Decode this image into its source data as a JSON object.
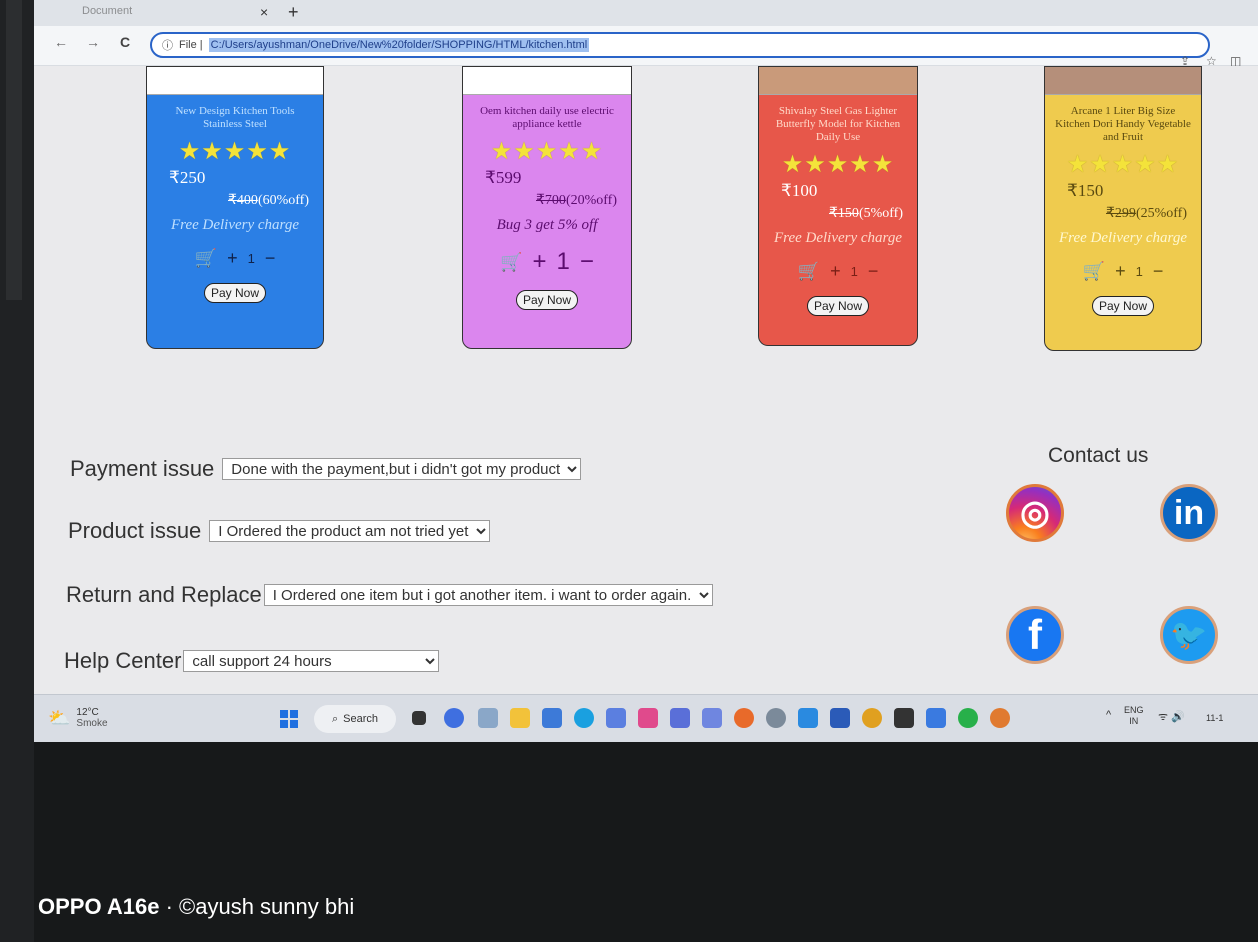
{
  "browser": {
    "tab_title": "Document",
    "tab_close": "×",
    "new_tab": "+",
    "back": "←",
    "forward": "→",
    "reload": "C",
    "url_prefix": "File |",
    "url": "C:/Users/ayushman/OneDrive/New%20folder/SHOPPING/HTML/kitchen.html"
  },
  "products": [
    {
      "name": "New Design Kitchen Tools Stainless Steel",
      "stars": "★★★★★",
      "price": "₹250",
      "old_price": "₹400",
      "discount": "(60%off)",
      "offer": "Free Delivery charge",
      "cart_icon": "🛒",
      "plus": "+",
      "qty": "1",
      "minus": "−",
      "button": "Pay Now"
    },
    {
      "name": "Oem kitchen daily use electric appliance kettle",
      "stars": "★★★★★",
      "price": "₹599",
      "old_price": "₹700",
      "discount": "(20%off)",
      "offer": "Bug 3 get 5% off",
      "cart_icon": "🛒",
      "plus": "+",
      "qty": "1",
      "minus": "−",
      "button": "Pay Now"
    },
    {
      "name": "Shivalay Steel Gas Lighter Butterfly Model for Kitchen Daily Use",
      "stars": "★★★★★",
      "price": "₹100",
      "old_price": "₹150",
      "discount": "(5%off)",
      "offer": "Free Delivery charge",
      "cart_icon": "🛒",
      "plus": "+",
      "qty": "1",
      "minus": "−",
      "button": "Pay Now"
    },
    {
      "name": "Arcane 1 Liter Big Size Kitchen Dori Handy Vegetable and Fruit",
      "stars": "★★★★★",
      "price": "₹150",
      "old_price": "₹299",
      "discount": "(25%off)",
      "offer": "Free Delivery charge",
      "cart_icon": "🛒",
      "plus": "+",
      "qty": "1",
      "minus": "−",
      "button": "Pay Now"
    }
  ],
  "support": {
    "payment_label": "Payment issue",
    "payment_value": "Done with the payment,but i didn't got my product",
    "product_label": "Product issue",
    "product_value": "I Ordered the product am not tried yet",
    "return_label": "Return and Replace",
    "return_value": "I Ordered one item but i got another item. i want to order again.",
    "help_label": "Help Center",
    "help_value": "call support 24 hours"
  },
  "contact": {
    "title": "Contact us",
    "instagram": "◎",
    "linkedin": "in",
    "facebook": "f",
    "twitter": "🐦"
  },
  "taskbar": {
    "temperature": "12°C",
    "condition": "Smoke",
    "search": "Search",
    "lang_top": "ENG",
    "lang_bottom": "IN",
    "tray_up": "^",
    "tray_icons": "ᯤ 🔊",
    "clock": "11-1"
  },
  "watermark": {
    "device": "OPPO A16e",
    "credit": " · ©ayush sunny bhi"
  },
  "colors": {
    "card1": "#2b7fe5",
    "card2": "#db86ee",
    "card3": "#e7574a",
    "card4": "#efcb4e",
    "star": "#f4e33a"
  }
}
